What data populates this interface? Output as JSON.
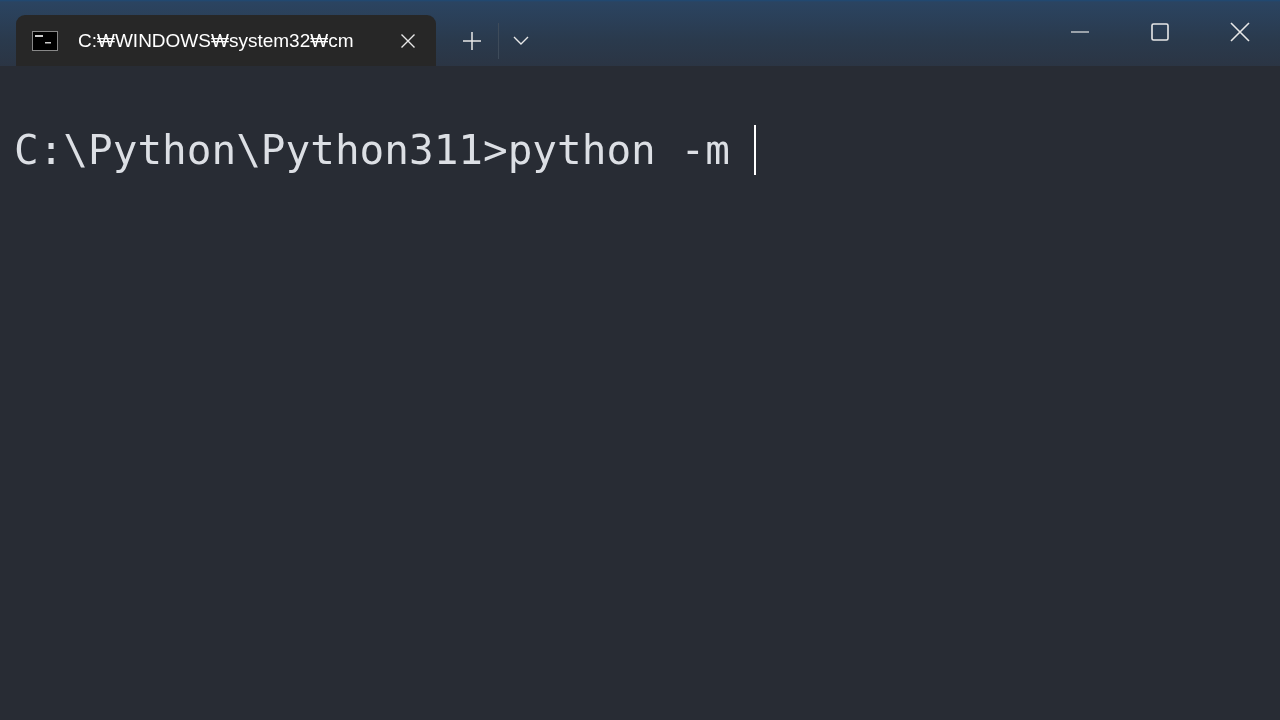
{
  "tabs": [
    {
      "title": "C:₩WINDOWS₩system32₩cm",
      "selected": true
    }
  ],
  "terminal": {
    "lines": [
      "C:\\Python\\Python311>python -m"
    ],
    "cursor": true
  }
}
